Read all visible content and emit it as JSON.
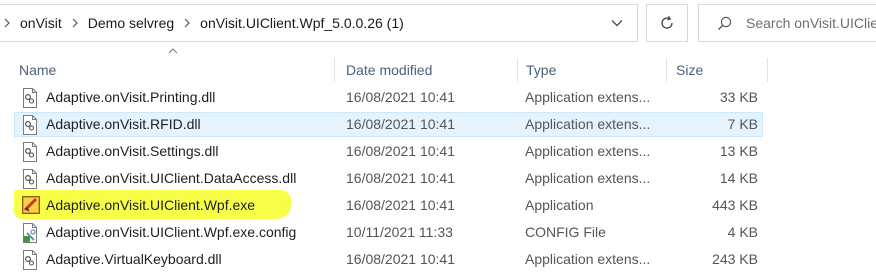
{
  "address_bar": {
    "crumbs": [
      "onVisit",
      "Demo selvreg",
      "onVisit.UIClient.Wpf_5.0.0.26 (1)"
    ]
  },
  "search": {
    "placeholder": "Search onVisit.UIClient.Wpf_5.0.0.26 (1)"
  },
  "columns": {
    "name": "Name",
    "date": "Date modified",
    "type": "Type",
    "size": "Size"
  },
  "files": [
    {
      "name": "Adaptive.onVisit.Printing.dll",
      "date": "16/08/2021 10:41",
      "type": "Application extens...",
      "size": "33 KB",
      "icon": "dll-icon"
    },
    {
      "name": "Adaptive.onVisit.RFID.dll",
      "date": "16/08/2021 10:41",
      "type": "Application extens...",
      "size": "7 KB",
      "icon": "dll-icon",
      "selected": true
    },
    {
      "name": "Adaptive.onVisit.Settings.dll",
      "date": "16/08/2021 10:41",
      "type": "Application extens...",
      "size": "13 KB",
      "icon": "dll-icon"
    },
    {
      "name": "Adaptive.onVisit.UIClient.DataAccess.dll",
      "date": "16/08/2021 10:41",
      "type": "Application extens...",
      "size": "14 KB",
      "icon": "dll-icon"
    },
    {
      "name": "Adaptive.onVisit.UIClient.Wpf.exe",
      "date": "16/08/2021 10:41",
      "type": "Application",
      "size": "443 KB",
      "icon": "exe-app-icon",
      "highlighted": true
    },
    {
      "name": "Adaptive.onVisit.UIClient.Wpf.exe.config",
      "date": "10/11/2021 11:33",
      "type": "CONFIG File",
      "size": "4 KB",
      "icon": "config-file-icon"
    },
    {
      "name": "Adaptive.VirtualKeyboard.dll",
      "date": "16/08/2021 10:41",
      "type": "Application extens...",
      "size": "243 KB",
      "icon": "dll-icon"
    }
  ],
  "colors": {
    "highlight": "#f6ff3a",
    "selection": "#e5f3ff",
    "header_text": "#4c607a"
  }
}
